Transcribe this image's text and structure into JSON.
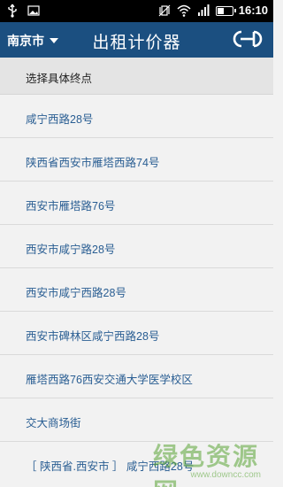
{
  "status_bar": {
    "time": "16:10",
    "icons": [
      "usb-icon",
      "vibrate-silent-icon",
      "wifi-icon",
      "signal-icon",
      "battery-icon"
    ]
  },
  "header": {
    "city": "南京市",
    "title": "出租计价器",
    "logo_icon": "taxi-logo-icon",
    "color": "#1b4f80"
  },
  "section": {
    "label": "选择具体终点"
  },
  "list": {
    "items": [
      "咸宁西路28号",
      "陕西省西安市雁塔西路74号",
      "西安市雁塔路76号",
      "西安市咸宁路28号",
      "西安市咸宁西路28号",
      "西安市碑林区咸宁西路28号",
      "雁塔西路76西安交通大学医学校区",
      "交大商场街",
      "［ 陕西省.西安市 ］ 咸宁西路28号"
    ],
    "link_color": "#2a5e93"
  },
  "watermark": {
    "text": "绿色资源网",
    "url": "www.downcc.com"
  }
}
